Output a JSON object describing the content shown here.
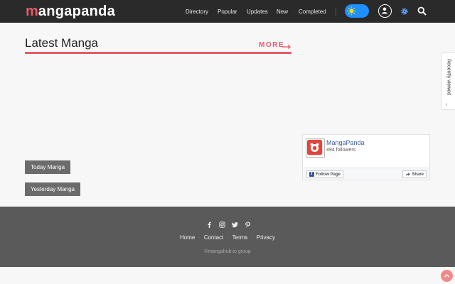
{
  "header": {
    "logo_first": "m",
    "logo_rest": "angapanda",
    "nav": [
      "Directory",
      "Popular",
      "Updates",
      "New",
      "Completed"
    ],
    "icons": [
      "sun-icon",
      "user-icon",
      "gear-icon",
      "search-icon"
    ]
  },
  "main": {
    "title": "Latest Manga",
    "more_label": "MORE",
    "buttons": [
      "Today Manga",
      "Yesterday Manga"
    ]
  },
  "recent_tab": {
    "label": "Recently viewed",
    "chevron": "‹"
  },
  "fb_widget": {
    "page_name": "MangaPanda",
    "followers": "494 followers",
    "follow_label": "Follow Page",
    "share_label": "Share"
  },
  "footer": {
    "socials": [
      "facebook-icon",
      "instagram-icon",
      "twitter-icon",
      "pinterest-icon"
    ],
    "links": [
      "Home",
      "Contact",
      "Terms",
      "Privacy"
    ],
    "copyright": "©mangahub.io group"
  },
  "colors": {
    "accent": "#e85a6a",
    "header_bg": "#2a2a2a",
    "footer_bg": "#5a5a5a",
    "toggle": "#1e90ff"
  }
}
